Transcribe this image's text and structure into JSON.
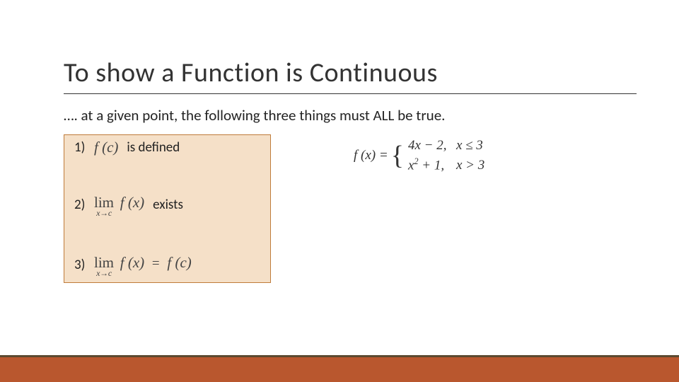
{
  "title": "To show a Function is Continuous",
  "subtitle": "…. at a given point, the following three things must ALL be true.",
  "conditions": {
    "item1": {
      "num": "1)",
      "expr": "f (c)",
      "text": "is defined"
    },
    "item2": {
      "num": "2)",
      "lim": "lim",
      "sub": "x→c",
      "expr": "f (x)",
      "text": "exists"
    },
    "item3": {
      "num": "3)",
      "lim": "lim",
      "sub": "x→c",
      "lhs": "f (x)",
      "eq": "=",
      "rhs": "f (c)"
    }
  },
  "example": {
    "lhs": "f (x) =",
    "case1": {
      "expr": "4x − 2,",
      "cond": "x ≤ 3"
    },
    "case2": {
      "expr_pre": "x",
      "expr_sup": "2",
      "expr_post": " + 1,",
      "cond": "x > 3"
    }
  }
}
